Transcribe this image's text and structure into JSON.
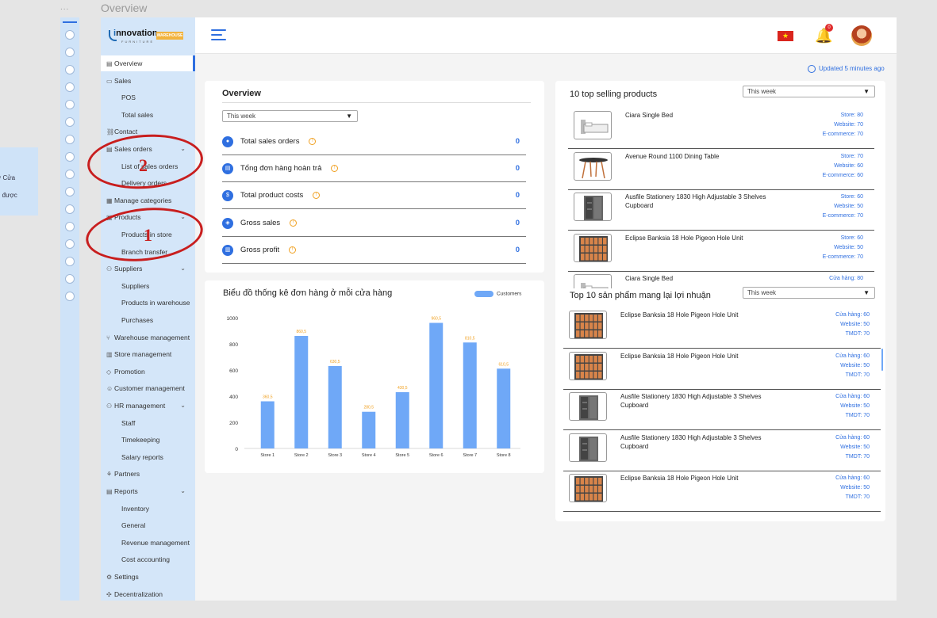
{
  "frame": {
    "title": "Overview",
    "dots": "..."
  },
  "side_note": {
    "line1": "ở Cửa",
    "line2": "g được"
  },
  "brand": {
    "name_i": "i",
    "name_rest": "nnovation",
    "tag": "WAREHOUSE",
    "sub": "FURNITURE"
  },
  "sidebar": {
    "items": [
      {
        "label": "Overview",
        "icon": "doc-icon",
        "glyph": "▤",
        "kind": "top",
        "active": true
      },
      {
        "label": "Sales",
        "icon": "wallet-icon",
        "glyph": "▭",
        "kind": "top"
      },
      {
        "label": "POS",
        "kind": "sub"
      },
      {
        "label": "Total sales",
        "kind": "sub"
      },
      {
        "label": "Contact",
        "icon": "link-icon",
        "glyph": "⛓",
        "kind": "top"
      },
      {
        "label": "Sales orders",
        "icon": "receipt-icon",
        "glyph": "▤",
        "kind": "top",
        "chevron": "⌄"
      },
      {
        "label": "List of sales orders",
        "kind": "sub"
      },
      {
        "label": "Delivery orders",
        "kind": "sub"
      },
      {
        "label": "Manage categories",
        "icon": "grid-icon",
        "glyph": "▦",
        "kind": "top"
      },
      {
        "label": "Products",
        "icon": "box-icon",
        "glyph": "▣",
        "kind": "top",
        "chevron": "⌄"
      },
      {
        "label": "Products in store",
        "kind": "sub"
      },
      {
        "label": "Branch transfer",
        "kind": "sub"
      },
      {
        "label": "Suppliers",
        "icon": "people-icon",
        "glyph": "⚇",
        "kind": "top",
        "chevron": "⌄"
      },
      {
        "label": "Suppliers",
        "kind": "sub"
      },
      {
        "label": "Products in warehouse",
        "kind": "sub"
      },
      {
        "label": "Purchases",
        "kind": "sub"
      },
      {
        "label": "Warehouse management",
        "icon": "branch-icon",
        "glyph": "⑂",
        "kind": "top"
      },
      {
        "label": "Store management",
        "icon": "store-icon",
        "glyph": "▥",
        "kind": "top"
      },
      {
        "label": "Promotion",
        "icon": "tag-icon",
        "glyph": "◇",
        "kind": "top"
      },
      {
        "label": "Customer management",
        "icon": "user-icon",
        "glyph": "☺",
        "kind": "top"
      },
      {
        "label": "HR management",
        "icon": "team-icon",
        "glyph": "⚇",
        "kind": "top",
        "chevron": "⌄"
      },
      {
        "label": "Staff",
        "kind": "sub"
      },
      {
        "label": "Timekeeping",
        "kind": "sub"
      },
      {
        "label": "Salary reports",
        "kind": "sub"
      },
      {
        "label": "Partners",
        "icon": "handshake-icon",
        "glyph": "⚘",
        "kind": "top"
      },
      {
        "label": "Reports",
        "icon": "report-icon",
        "glyph": "▤",
        "kind": "top",
        "chevron": "⌄"
      },
      {
        "label": "Inventory",
        "kind": "sub"
      },
      {
        "label": "General",
        "kind": "sub"
      },
      {
        "label": "Revenue management",
        "kind": "sub"
      },
      {
        "label": "Cost accounting",
        "kind": "sub"
      },
      {
        "label": "Settings",
        "icon": "gear-icon",
        "glyph": "⚙",
        "kind": "top"
      },
      {
        "label": "Decentralization",
        "icon": "permission-icon",
        "glyph": "✣",
        "kind": "top"
      }
    ]
  },
  "topbar": {
    "flag_glyph": "★",
    "bell_glyph": "🔔",
    "bell_badge": "0"
  },
  "updated": "Updated 5 minutes ago",
  "overview": {
    "title": "Overview",
    "period": "This week",
    "caret": "▼",
    "info_glyph": "!",
    "rows": [
      {
        "label": "Total sales orders",
        "value": "0",
        "icon": "cart-icon",
        "glyph": "●"
      },
      {
        "label": "Tổng đơn hàng hoàn trả",
        "value": "0",
        "icon": "return-icon",
        "glyph": "▤"
      },
      {
        "label": "Total product costs",
        "value": "0",
        "icon": "cost-icon",
        "glyph": "$"
      },
      {
        "label": "Gross sales",
        "value": "0",
        "icon": "gift-icon",
        "glyph": "◈"
      },
      {
        "label": "Gross profit",
        "value": "0",
        "icon": "profit-icon",
        "glyph": "▥"
      }
    ]
  },
  "chart_data": {
    "type": "bar",
    "title": "Biểu đồ thống kê đơn hàng ở mỗi cửa hàng",
    "categories": [
      "Store 1",
      "Store 2",
      "Store 3",
      "Store 4",
      "Store 5",
      "Store 6",
      "Store 7",
      "Store 8"
    ],
    "series": [
      {
        "name": "Customers",
        "values": [
          360.5,
          860.5,
          630.5,
          280.5,
          430.5,
          960.5,
          810.5,
          610.5
        ],
        "labels": [
          "360,5",
          "860,5",
          "630,5",
          "280,5",
          "430,5",
          "960,5",
          "810,5",
          "610,5"
        ],
        "color": "#6fa8f7"
      }
    ],
    "ylim": [
      0,
      1000
    ],
    "yticks": [
      0,
      200,
      400,
      600,
      800,
      1000
    ],
    "label_color": "#f0a020",
    "grid": false,
    "legend": "top-right"
  },
  "top_selling": {
    "title": "10 top selling products",
    "period": "This week",
    "caret": "▼",
    "items": [
      {
        "name": "Ciara Single Bed",
        "stats": [
          "Store: 80",
          "Website: 70",
          "E-commerce: 70"
        ],
        "thumb": "bed"
      },
      {
        "name": "Avenue Round 1100 Dining Table",
        "stats": [
          "Store: 70",
          "Website: 60",
          "E-commerce: 60"
        ],
        "thumb": "table"
      },
      {
        "name": "Ausfile Stationery 1830 High Adjustable 3 Shelves Cupboard",
        "stats": [
          "Store: 60",
          "Website: 50",
          "E-commerce: 70"
        ],
        "thumb": "cupboard"
      },
      {
        "name": "Eclipse Banksia 18 Hole Pigeon Hole Unit",
        "stats": [
          "Store: 60",
          "Website: 50",
          "E-commerce: 70"
        ],
        "thumb": "pigeon"
      },
      {
        "name": "Ciara Single Bed",
        "stats": [
          "Cửa hàng: 80"
        ],
        "thumb": "bed"
      }
    ]
  },
  "top_profit": {
    "title": "Top 10 sản phẩm mang lại lợi nhuận",
    "period": "This week",
    "caret": "▼",
    "items": [
      {
        "name": "Eclipse Banksia 18 Hole Pigeon Hole Unit",
        "stats": [
          "Cửa hàng: 60",
          "Website: 50",
          "TMDT: 70"
        ],
        "thumb": "pigeon"
      },
      {
        "name": "Eclipse Banksia 18 Hole Pigeon Hole Unit",
        "stats": [
          "Cửa hàng: 60",
          "Website: 50",
          "TMDT: 70"
        ],
        "thumb": "pigeon"
      },
      {
        "name": "Ausfile Stationery 1830 High Adjustable 3 Shelves Cupboard",
        "stats": [
          "Cửa hàng: 60",
          "Website: 50",
          "TMDT: 70"
        ],
        "thumb": "cupboard"
      },
      {
        "name": "Ausfile Stationery 1830 High Adjustable 3 Shelves Cupboard",
        "stats": [
          "Cửa hàng: 60",
          "Website: 50",
          "TMDT: 70"
        ],
        "thumb": "cupboard"
      },
      {
        "name": "Eclipse Banksia 18 Hole Pigeon Hole Unit",
        "stats": [
          "Cửa hàng: 60",
          "Website: 50",
          "TMDT: 70"
        ],
        "thumb": "pigeon"
      }
    ]
  },
  "annotations": {
    "one": "1",
    "two": "2",
    "color": "#c81e1e"
  }
}
